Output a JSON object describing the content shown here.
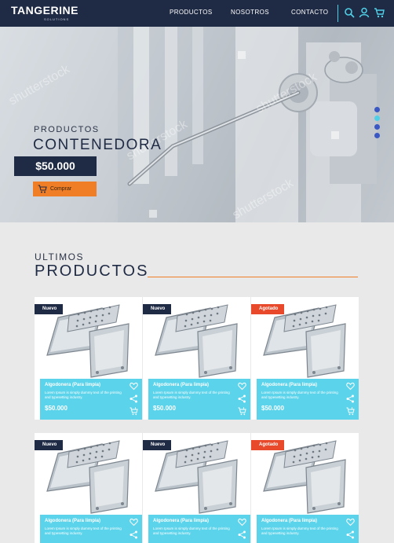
{
  "nav": {
    "brand": "TANGERINE",
    "brand_sub": "SOLUTIONS",
    "links": [
      "PRODUCTOS",
      "NOSOTROS",
      "CONTACTO"
    ]
  },
  "hero": {
    "subtitle": "PRODUCTOS",
    "title": "CONTENEDORA",
    "price": "$50.000",
    "buy_label": "Comprar"
  },
  "section": {
    "subtitle": "ULTIMOS",
    "title": "PRODUCTOS"
  },
  "products": [
    {
      "badge": "Nuevo",
      "badge_type": "new",
      "name": "Algodonera (Para limpia)",
      "desc": "Lorem Ipsum is simply dummy text of the printing and typesetting industry.",
      "price": "$50.000"
    },
    {
      "badge": "Nuevo",
      "badge_type": "new",
      "name": "Algodonera (Para limpia)",
      "desc": "Lorem Ipsum is simply dummy text of the printing and typesetting industry.",
      "price": "$50.000"
    },
    {
      "badge": "Agotado",
      "badge_type": "hot",
      "name": "Algodonera (Para limpia)",
      "desc": "Lorem Ipsum is simply dummy text of the printing and typesetting industry.",
      "price": "$50.000"
    },
    {
      "badge": "Nuevo",
      "badge_type": "new",
      "name": "Algodonera (Para limpia)",
      "desc": "Lorem Ipsum is simply dummy text of the printing and typesetting industry.",
      "price": ""
    },
    {
      "badge": "Nuevo",
      "badge_type": "new",
      "name": "Algodonera (Para limpia)",
      "desc": "Lorem Ipsum is simply dummy text of the printing and typesetting industry.",
      "price": ""
    },
    {
      "badge": "Agotado",
      "badge_type": "hot",
      "name": "Algodonera (Para limpia)",
      "desc": "Lorem Ipsum is simply dummy text of the printing and typesetting industry.",
      "price": ""
    }
  ],
  "colors": {
    "navy": "#1f2a44",
    "orange": "#f07e26",
    "cyan": "#5bd3ea",
    "red": "#e9492b",
    "dot_active": "#4fd0e6",
    "dot": "#3a57c4"
  }
}
